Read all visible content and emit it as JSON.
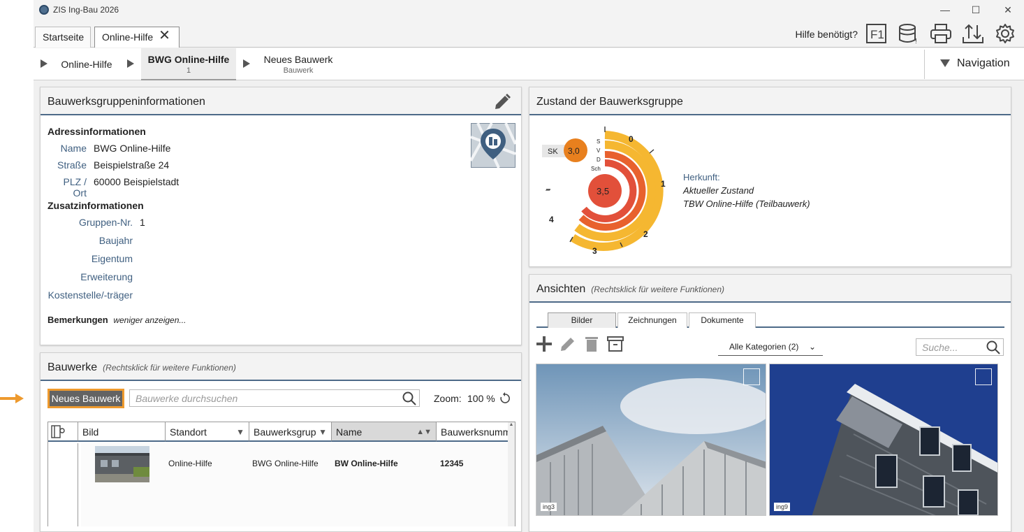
{
  "window": {
    "title": "ZIS Ing-Bau 2026"
  },
  "tabs": [
    {
      "label": "Startseite"
    },
    {
      "label": "Online-Hilfe"
    }
  ],
  "toolbar": {
    "help_label": "Hilfe benötigt?",
    "f1_label": "F1"
  },
  "breadcrumb": {
    "items": [
      {
        "label": "Online-Hilfe",
        "sub": ""
      },
      {
        "label": "BWG Online-Hilfe",
        "sub": "1"
      },
      {
        "label": "Neues Bauwerk",
        "sub": "Bauwerk"
      }
    ],
    "navigation_label": "Navigation"
  },
  "info_panel": {
    "title": "Bauwerksgruppeninformationen",
    "address_heading": "Adressinformationen",
    "address": [
      {
        "label": "Name",
        "value": "BWG Online-Hilfe"
      },
      {
        "label": "Straße",
        "value": "Beispielstraße 24"
      },
      {
        "label": "PLZ / Ort",
        "value": "60000 Beispielstadt"
      }
    ],
    "extra_heading": "Zusatzinformationen",
    "extra": [
      {
        "label": "Gruppen-Nr.",
        "value": "1"
      },
      {
        "label": "Baujahr",
        "value": ""
      },
      {
        "label": "Eigentum",
        "value": ""
      },
      {
        "label": "Erweiterung",
        "value": ""
      },
      {
        "label": "Kostenstelle/-träger",
        "value": ""
      }
    ],
    "remarks_label": "Bemerkungen",
    "remarks_toggle": "weniger anzeigen..."
  },
  "bauwerke_panel": {
    "title": "Bauwerke",
    "hint": "(Rechtsklick für weitere Funktionen)",
    "new_button": "Neues Bauwerk",
    "search_placeholder": "Bauwerke durchsuchen",
    "zoom_label": "Zoom:",
    "zoom_value": "100 %",
    "columns": [
      "Bild",
      "Standort",
      "Bauwerksgrup",
      "Name",
      "Bauwerksnumm"
    ],
    "rows": [
      {
        "standort": "Online-Hilfe",
        "gruppe": "BWG Online-Hilfe",
        "name": "BW Online-Hilfe",
        "nummer": "12345"
      }
    ]
  },
  "zustand_panel": {
    "title": "Zustand der Bauwerksgruppe",
    "sk_label": "SK",
    "sk_value": "3,0",
    "center_value": "3,5",
    "ring_labels": [
      "S",
      "V",
      "D",
      "Sch"
    ],
    "scale_labels": [
      "0",
      "1",
      "2",
      "3",
      "4"
    ],
    "dash_label": "–",
    "origin_label": "Herkunft:",
    "origin_lines": [
      "Aktueller Zustand",
      "TBW Online-Hilfe (Teilbauwerk)"
    ],
    "colors": {
      "orange": "#e8801e",
      "red": "#e2503a",
      "yellow": "#f5b731"
    }
  },
  "ansichten_panel": {
    "title": "Ansichten",
    "hint": "(Rechtsklick für weitere Funktionen)",
    "tabs": [
      "Bilder",
      "Zeichnungen",
      "Dokumente"
    ],
    "category": "Alle Kategorien (2)",
    "search_placeholder": "Suche...",
    "images": [
      {
        "tag": "ing3"
      },
      {
        "tag": "ing9"
      }
    ]
  },
  "colors": {
    "accent": "#4d6a88",
    "highlight": "#ee9a2e"
  }
}
